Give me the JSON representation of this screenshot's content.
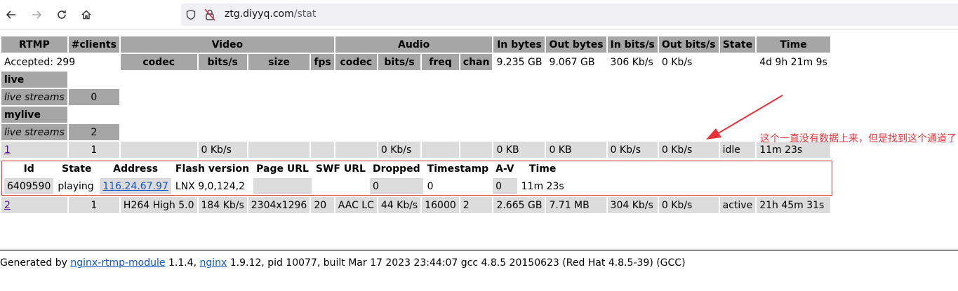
{
  "browser": {
    "url_domain": "ztg.diyyq.com",
    "url_path": "/stat"
  },
  "header": {
    "rtmp": "RTMP",
    "clients": "#clients",
    "video": "Video",
    "audio": "Audio",
    "in_bytes": "In bytes",
    "out_bytes": "Out bytes",
    "in_bits": "In bits/s",
    "out_bits": "Out bits/s",
    "state": "State",
    "time": "Time",
    "video_sub": [
      "codec",
      "bits/s",
      "size",
      "fps"
    ],
    "audio_sub": [
      "codec",
      "bits/s",
      "freq",
      "chan"
    ]
  },
  "summary": {
    "accepted": "Accepted: 299",
    "in_bytes": "9.235 GB",
    "out_bytes": "9.067 GB",
    "in_bits": "306 Kb/s",
    "out_bits": "0 Kb/s",
    "time": "4d 9h 21m 9s"
  },
  "apps": [
    {
      "name": "live",
      "streams_label": "live streams",
      "streams_count": "0"
    },
    {
      "name": "mylive",
      "streams_label": "live streams",
      "streams_count": "2"
    }
  ],
  "stream1": {
    "name": "1",
    "clients": "1",
    "video_bits": "0 Kb/s",
    "audio_bits": "0 Kb/s",
    "in_bytes": "0 KB",
    "out_bytes": "0 KB",
    "in_bits": "0 Kb/s",
    "out_bits": "0 Kb/s",
    "state": "idle",
    "time": "11m 23s"
  },
  "client_header": [
    "Id",
    "State",
    "Address",
    "Flash version",
    "Page URL",
    "SWF URL",
    "Dropped",
    "Timestamp",
    "A-V",
    "Time"
  ],
  "client1": {
    "id": "6409590",
    "state": "playing",
    "address": "116.24.67.97",
    "flash": "LNX 9,0,124,2",
    "page_url": "",
    "swf_url": "",
    "dropped": "0",
    "timestamp": "0",
    "av": "0",
    "time": "11m 23s"
  },
  "stream2": {
    "name": "2",
    "clients": "1",
    "vcodec": "H264 High 5.0",
    "vbits": "184 Kb/s",
    "size": "2304x1296",
    "fps": "20",
    "acodec": "AAC LC",
    "abits": "44 Kb/s",
    "freq": "16000",
    "chan": "2",
    "in_bytes": "2.665 GB",
    "out_bytes": "7.71 MB",
    "in_bits": "304 Kb/s",
    "out_bits": "0 Kb/s",
    "state": "active",
    "time": "21h 45m 31s"
  },
  "footer": {
    "prefix": "Generated by ",
    "module_link": "nginx-rtmp-module",
    "module_version": " 1.1.4, ",
    "nginx_link": "nginx",
    "rest": " 1.9.12, pid 10077, built Mar 17 2023 23:44:07 gcc 4.8.5 20150623 (Red Hat 4.8.5-39) (GCC)"
  },
  "annotation": {
    "text": "这个一直没有数据上来，但是找到这个通道了",
    "color": "#e8323a"
  }
}
